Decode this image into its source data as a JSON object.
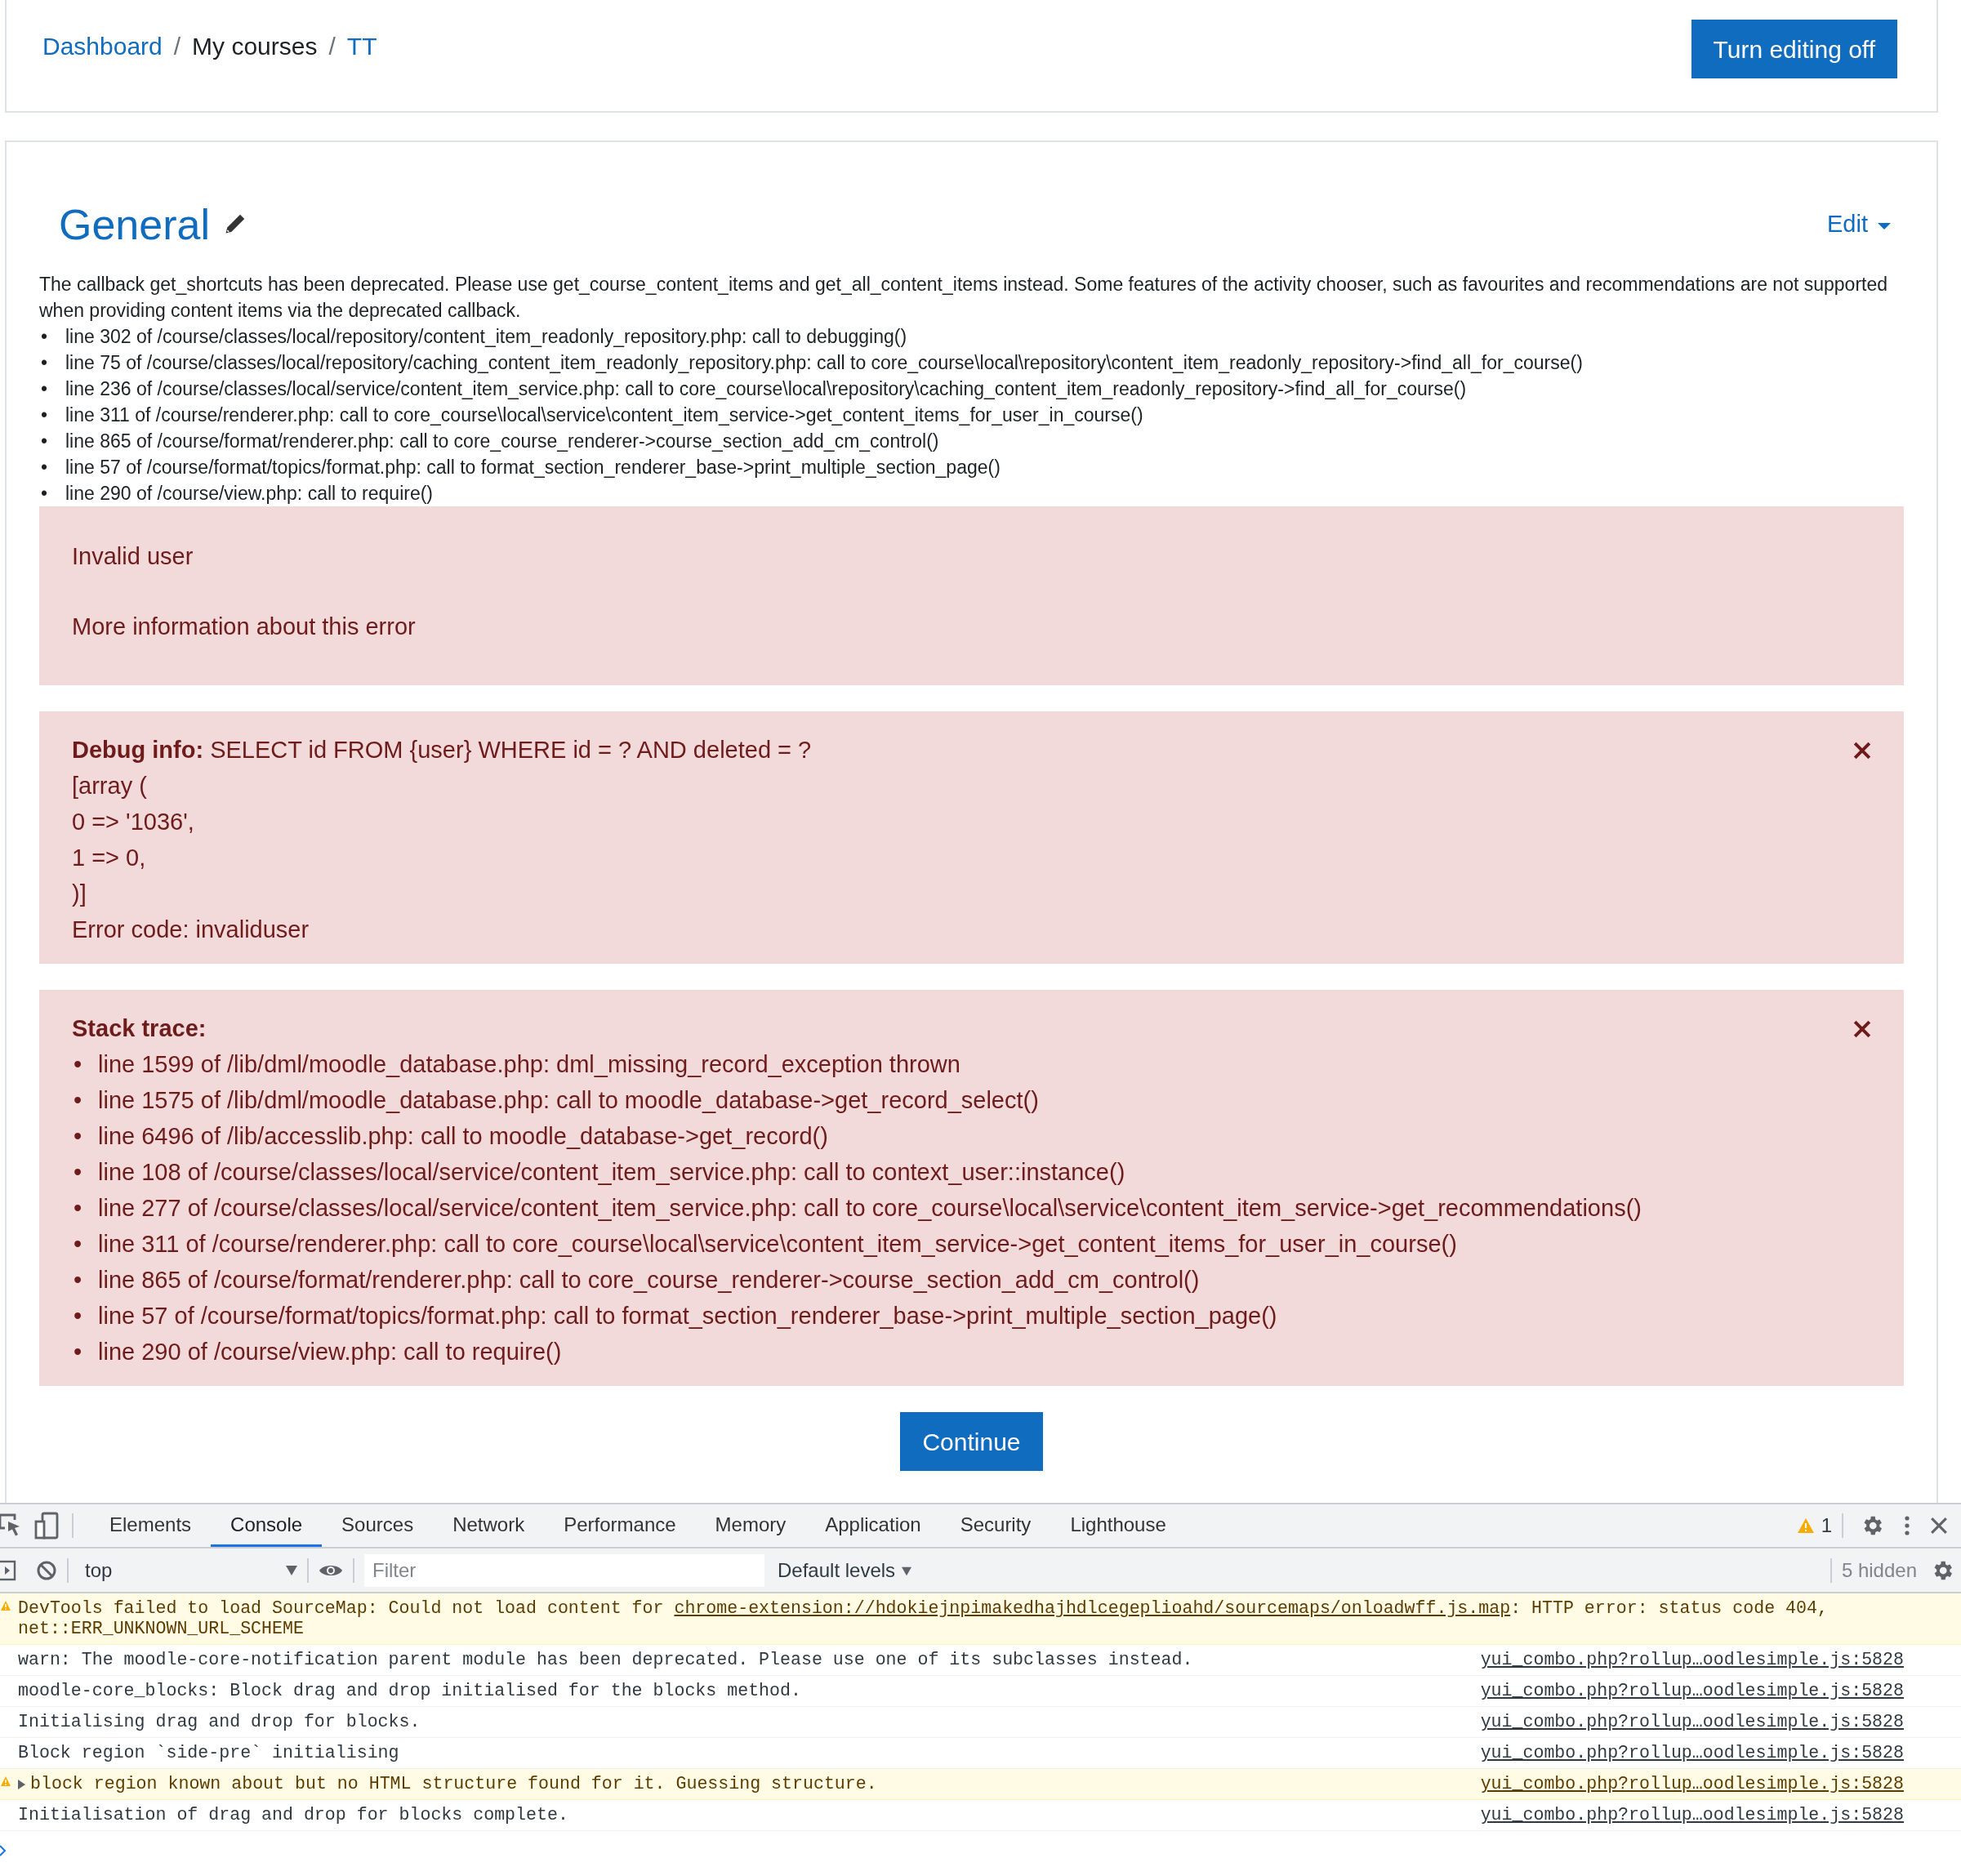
{
  "breadcrumb_separator": "/",
  "bullet": "•",
  "breadcrumb": [
    {
      "label": "Dashboard",
      "kind": "link"
    },
    {
      "label": "My courses",
      "kind": "text"
    },
    {
      "label": "TT",
      "kind": "link"
    }
  ],
  "edit_button": "Turn editing off",
  "section": {
    "title": "General",
    "edit_menu": "Edit"
  },
  "deprecation": {
    "message": "The callback get_shortcuts has been deprecated. Please use get_course_content_items and get_all_content_items instead. Some features of the activity chooser, such as favourites and recommendations are not supported when providing content items via the deprecated callback.",
    "trace": [
      "line 302 of /course/classes/local/repository/content_item_readonly_repository.php: call to debugging()",
      "line 75 of /course/classes/local/repository/caching_content_item_readonly_repository.php: call to core_course\\local\\repository\\content_item_readonly_repository->find_all_for_course()",
      "line 236 of /course/classes/local/service/content_item_service.php: call to core_course\\local\\repository\\caching_content_item_readonly_repository->find_all_for_course()",
      "line 311 of /course/renderer.php: call to core_course\\local\\service\\content_item_service->get_content_items_for_user_in_course()",
      "line 865 of /course/format/renderer.php: call to core_course_renderer->course_section_add_cm_control()",
      "line 57 of /course/format/topics/format.php: call to format_section_renderer_base->print_multiple_section_page()",
      "line 290 of /course/view.php: call to require()"
    ]
  },
  "error_alert": {
    "message": "Invalid user",
    "more_info": "More information about this error"
  },
  "debug_alert": {
    "lines": [
      "**Debug info:** SELECT id FROM {user} WHERE id = ? AND deleted = ?",
      "[array (",
      "0 => '1036',",
      "1 => 0,",
      ")]",
      "Error code: invaliduser"
    ]
  },
  "stack_alert": {
    "heading": "Stack trace:",
    "items": [
      "line 1599 of /lib/dml/moodle_database.php: dml_missing_record_exception thrown",
      "line 1575 of /lib/dml/moodle_database.php: call to moodle_database->get_record_select()",
      "line 6496 of /lib/accesslib.php: call to moodle_database->get_record()",
      "line 108 of /course/classes/local/service/content_item_service.php: call to context_user::instance()",
      "line 277 of /course/classes/local/service/content_item_service.php: call to core_course\\local\\service\\content_item_service->get_recommendations()",
      "line 311 of /course/renderer.php: call to core_course\\local\\service\\content_item_service->get_content_items_for_user_in_course()",
      "line 865 of /course/format/renderer.php: call to core_course_renderer->course_section_add_cm_control()",
      "line 57 of /course/format/topics/format.php: call to format_section_renderer_base->print_multiple_section_page()",
      "line 290 of /course/view.php: call to require()"
    ]
  },
  "continue_button": "Continue",
  "devtools": {
    "tabs": [
      {
        "label": "Elements",
        "selected": false
      },
      {
        "label": "Console",
        "selected": true
      },
      {
        "label": "Sources",
        "selected": false
      },
      {
        "label": "Network",
        "selected": false
      },
      {
        "label": "Performance",
        "selected": false
      },
      {
        "label": "Memory",
        "selected": false
      },
      {
        "label": "Application",
        "selected": false
      },
      {
        "label": "Security",
        "selected": false
      },
      {
        "label": "Lighthouse",
        "selected": false
      }
    ],
    "warning_count": "1",
    "context": "top",
    "filter_placeholder": "Filter",
    "levels": "Default levels",
    "hidden": "5 hidden",
    "messages": [
      {
        "warning": true,
        "expandable": false,
        "text": "DevTools failed to load SourceMap: Could not load content for ",
        "link": "chrome-extension://hdokiejnpimakedhajhdlcegeplioahd/sourcemaps/onloadwff.js.map",
        "text_after": ": HTTP error: status code 404, net::ERR_UNKNOWN_URL_SCHEME"
      },
      {
        "warning": false,
        "expandable": false,
        "text": "warn: The moodle-core-notification parent module has been deprecated. Please use one of its subclasses instead.",
        "source": "yui_combo.php?rollup…oodlesimple.js:5828"
      },
      {
        "warning": false,
        "expandable": false,
        "text": "moodle-core_blocks: Block drag and drop initialised for the blocks method.",
        "source": "yui_combo.php?rollup…oodlesimple.js:5828"
      },
      {
        "warning": false,
        "expandable": false,
        "text": "Initialising drag and drop for blocks.",
        "source": "yui_combo.php?rollup…oodlesimple.js:5828"
      },
      {
        "warning": false,
        "expandable": false,
        "text": "Block region `side-pre` initialising",
        "source": "yui_combo.php?rollup…oodlesimple.js:5828"
      },
      {
        "warning": true,
        "expandable": true,
        "text": "block region known about but no HTML structure found for it. Guessing structure.",
        "source": "yui_combo.php?rollup…oodlesimple.js:5828"
      },
      {
        "warning": false,
        "expandable": false,
        "text": "Initialisation of drag and drop for blocks complete.",
        "source": "yui_combo.php?rollup…oodlesimple.js:5828"
      }
    ]
  }
}
